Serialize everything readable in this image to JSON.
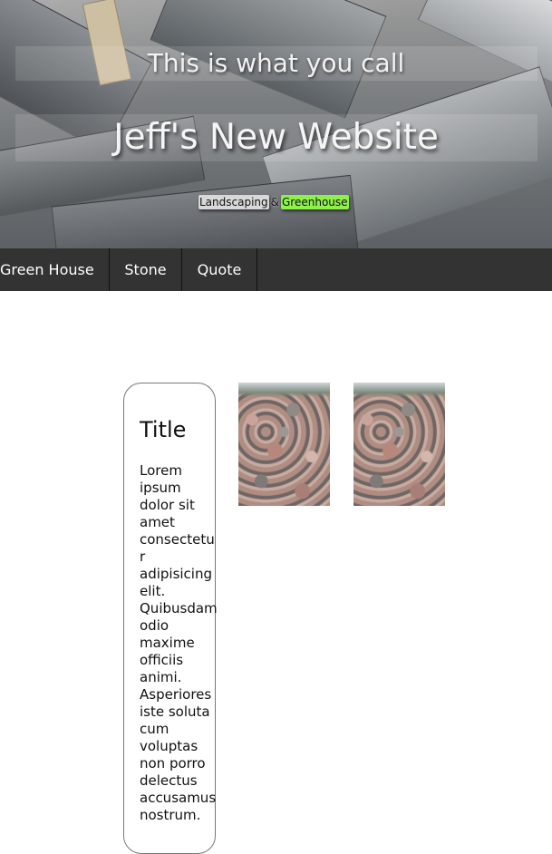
{
  "header": {
    "subtitle": "This is what you call",
    "title": "Jeff's New Website",
    "tagline": {
      "part1": "Landscaping",
      "separator": "&",
      "part2": "Greenhouse"
    }
  },
  "nav": {
    "items": [
      {
        "label": "Green House"
      },
      {
        "label": "Stone"
      },
      {
        "label": "Quote"
      }
    ]
  },
  "card": {
    "title": "Title",
    "body": "Lorem ipsum dolor sit amet consectetur adipisicing elit. Quibusdam odio maxime officiis animi. Asperiores iste soluta cum voluptas non porro delectus accusamus nostrum."
  },
  "colors": {
    "nav_background": "#333333",
    "tag_highlight": "#8ef04a"
  },
  "gallery": {
    "images": [
      "stone-pile-photo",
      "stone-field-photo"
    ]
  }
}
